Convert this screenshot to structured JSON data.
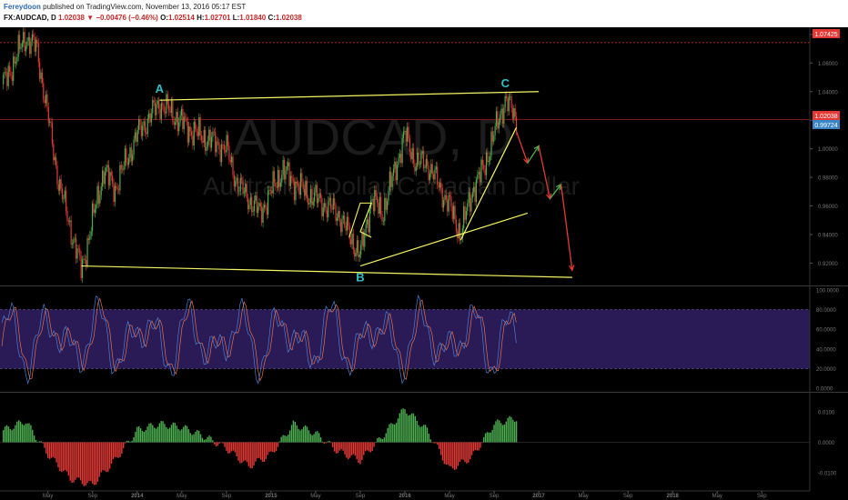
{
  "header": {
    "author": "Fereydoon",
    "published": "published on TradingView.com, November 13, 2016 05:17 EST",
    "symbol": "FX:AUDCAD, D",
    "last": "1.02038",
    "change_arrow": "▼",
    "change": "−0.00476 (−0.46%)",
    "o_label": "O:",
    "o": "1.02514",
    "h_label": "H:",
    "h": "1.02701",
    "l_label": "L:",
    "l": "1.01840",
    "c_label": "C:",
    "c": "1.02038"
  },
  "watermark": {
    "symbol": "AUDCAD, D",
    "name": "Australian Dollar/Canadian Dollar"
  },
  "labels": {
    "A": "A",
    "B": "B",
    "C": "C"
  },
  "price_badges": {
    "resistance": "1.07425",
    "last": "1.02038",
    "other": "0.99724"
  },
  "colors": {
    "up": "#4caf50",
    "down": "#e53935",
    "trendline": "#f5f562",
    "wave_label": "#30c0c8",
    "stoch_bg": "#2a1a55",
    "stoch_k": "#4a7fd4",
    "stoch_d": "#e8704a"
  },
  "chart_data": [
    {
      "type": "candlestick",
      "symbol": "FX:AUDCAD",
      "timeframe": "D",
      "ylim": [
        0.905,
        1.085
      ],
      "y_ticks": [
        "1.08000",
        "1.06000",
        "1.04000",
        "1.02000",
        "1.00000",
        "0.98000",
        "0.96000",
        "0.94000",
        "0.92000"
      ],
      "x_ticks": [
        "May",
        "Sep",
        "2014",
        "May",
        "Sep",
        "2015",
        "May",
        "Sep",
        "2016",
        "May",
        "Sep",
        "2017",
        "May",
        "Sep",
        "2018",
        "May",
        "Sep"
      ],
      "price_path": [
        {
          "x": "Jan 2013",
          "y": 1.045
        },
        {
          "x": "Mar 2013",
          "y": 1.078
        },
        {
          "x": "Apr 2013",
          "y": 1.07
        },
        {
          "x": "Jun 2013",
          "y": 0.975
        },
        {
          "x": "Aug 2013",
          "y": 0.915
        },
        {
          "x": "Oct 2013",
          "y": 0.985
        },
        {
          "x": "Nov 2013",
          "y": 0.972
        },
        {
          "x": "Jan 2014",
          "y": 1.01
        },
        {
          "x": "Mar 2014",
          "y": 1.032
        },
        {
          "x": "Jun 2014",
          "y": 1.012
        },
        {
          "x": "Sep 2014",
          "y": 1.0
        },
        {
          "x": "Oct 2014",
          "y": 0.975
        },
        {
          "x": "Dec 2014",
          "y": 0.955
        },
        {
          "x": "Feb 2015",
          "y": 0.985
        },
        {
          "x": "Apr 2015",
          "y": 0.97
        },
        {
          "x": "Jul 2015",
          "y": 0.955
        },
        {
          "x": "Sep 2015",
          "y": 0.925
        },
        {
          "x": "Oct 2015",
          "y": 0.965
        },
        {
          "x": "Nov 2015",
          "y": 0.955
        },
        {
          "x": "Jan 2016",
          "y": 1.01
        },
        {
          "x": "Feb 2016",
          "y": 0.99
        },
        {
          "x": "Mar 2016",
          "y": 0.99
        },
        {
          "x": "May 2016",
          "y": 0.96
        },
        {
          "x": "Jun 2016",
          "y": 0.94
        },
        {
          "x": "Jul 2016",
          "y": 0.97
        },
        {
          "x": "Aug 2016",
          "y": 0.985
        },
        {
          "x": "Oct 2016",
          "y": 1.035
        },
        {
          "x": "Nov 2016",
          "y": 1.02
        }
      ],
      "levels": {
        "resistance": 1.07425,
        "last": 1.02038,
        "other": 0.99724
      },
      "annotations": [
        {
          "label": "A",
          "x": "Mar 2014",
          "y": 1.034
        },
        {
          "label": "B",
          "x": "Sep 2015",
          "y": 0.92
        },
        {
          "label": "C",
          "x": "Oct 2016",
          "y": 1.038
        }
      ],
      "trendlines": [
        {
          "from": {
            "x": "Mar 2014",
            "y": 1.034
          },
          "to": {
            "x": "Jan 2017",
            "y": 1.04
          }
        },
        {
          "from": {
            "x": "Aug 2013",
            "y": 0.918
          },
          "to": {
            "x": "Apr 2017",
            "y": 0.91
          }
        },
        {
          "from": {
            "x": "Sep 2015",
            "y": 0.918
          },
          "to": {
            "x": "Dec 2016",
            "y": 0.955
          }
        },
        {
          "from": {
            "x": "Jun 2016",
            "y": 0.936
          },
          "to": {
            "x": "Nov 2016",
            "y": 1.015
          }
        }
      ],
      "projection_path": [
        {
          "x": "Nov 2016",
          "y": 1.012
        },
        {
          "x": "Dec 2016",
          "y": 0.99
        },
        {
          "x": "Jan 2017",
          "y": 1.002
        },
        {
          "x": "Feb 2017",
          "y": 0.965
        },
        {
          "x": "Mar 2017",
          "y": 0.975
        },
        {
          "x": "Apr 2017",
          "y": 0.915
        }
      ]
    },
    {
      "type": "line",
      "name": "stochastic",
      "ylim": [
        0,
        100
      ],
      "y_ticks": [
        "100.0000",
        "80.0000",
        "60.0000",
        "40.0000",
        "20.0000",
        "0.0000"
      ],
      "band": [
        20,
        80
      ]
    },
    {
      "type": "bar",
      "name": "histogram",
      "ylim": [
        -0.016,
        0.016
      ],
      "y_ticks": [
        "0.0100",
        "0.0000",
        "-0.0100"
      ],
      "x": [
        "Jan 2013",
        "Mar 2013",
        "May 2013",
        "Jul 2013",
        "Sep 2013",
        "Nov 2013",
        "Jan 2014",
        "Mar 2014",
        "May 2014",
        "Jul 2014",
        "Sep 2014",
        "Nov 2014",
        "Jan 2015",
        "Mar 2015",
        "May 2015",
        "Jul 2015",
        "Sep 2015",
        "Nov 2015",
        "Jan 2016",
        "Mar 2016",
        "May 2016",
        "Jul 2016",
        "Sep 2016",
        "Nov 2016"
      ],
      "values": [
        0.004,
        0.007,
        -0.004,
        -0.012,
        -0.014,
        -0.006,
        0.004,
        0.006,
        0.005,
        0.002,
        -0.002,
        -0.008,
        -0.004,
        0.006,
        0.003,
        -0.003,
        -0.006,
        0.002,
        0.011,
        0.004,
        -0.009,
        -0.005,
        0.006,
        0.008
      ]
    }
  ]
}
